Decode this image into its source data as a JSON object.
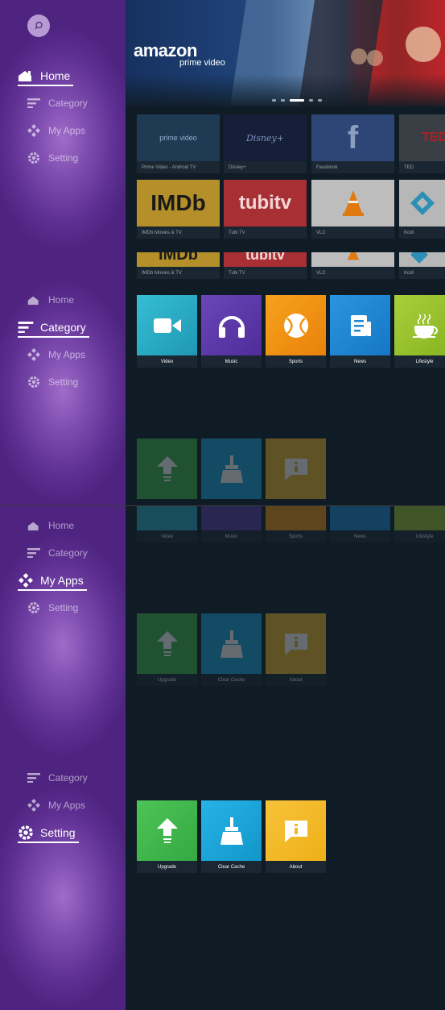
{
  "nav": {
    "search_icon": "search-icon",
    "home": "Home",
    "category": "Category",
    "my_apps": "My Apps",
    "setting": "Setting"
  },
  "banner": {
    "brand_line1": "amazon",
    "brand_line2": "prime video"
  },
  "apps": [
    {
      "title": "Prime Video - Android TV",
      "tile_text": "prime video",
      "color": "#1f3b54"
    },
    {
      "title": "Disney+",
      "tile_text": "Disney+",
      "color": "#152038"
    },
    {
      "title": "Facebook",
      "tile_text": "f",
      "color": "#2e4675"
    },
    {
      "title": "TED",
      "tile_text": "TED",
      "color": "#e8e8e8"
    },
    {
      "title": "IMDb Movies & TV",
      "tile_text": "IMDb",
      "color": "#e8b923"
    },
    {
      "title": "Tubi TV",
      "tile_text": "tubitv",
      "color": "#d8383b"
    },
    {
      "title": "VLC",
      "tile_text": "",
      "color": "#f2f2f2"
    },
    {
      "title": "Kodi",
      "tile_text": "",
      "color": "#e6e6e6"
    }
  ],
  "categories": [
    {
      "label": "Video",
      "color": "#2aa9c2",
      "icon": "video-icon"
    },
    {
      "label": "Music",
      "color": "#5a3aa6",
      "icon": "headphones-icon"
    },
    {
      "label": "Sports",
      "color": "#f2930f",
      "icon": "ball-icon"
    },
    {
      "label": "News",
      "color": "#1f86d2",
      "icon": "news-icon"
    },
    {
      "label": "Lifestyle",
      "color": "#99c32f",
      "icon": "cup-icon"
    }
  ],
  "settings": [
    {
      "label": "Upgrade",
      "color": "#3fb64a",
      "icon": "upgrade-arrow-icon"
    },
    {
      "label": "Clear Cache",
      "color": "#1aa4d9",
      "icon": "broom-icon"
    },
    {
      "label": "About",
      "color": "#f2b925",
      "icon": "info-icon"
    }
  ]
}
